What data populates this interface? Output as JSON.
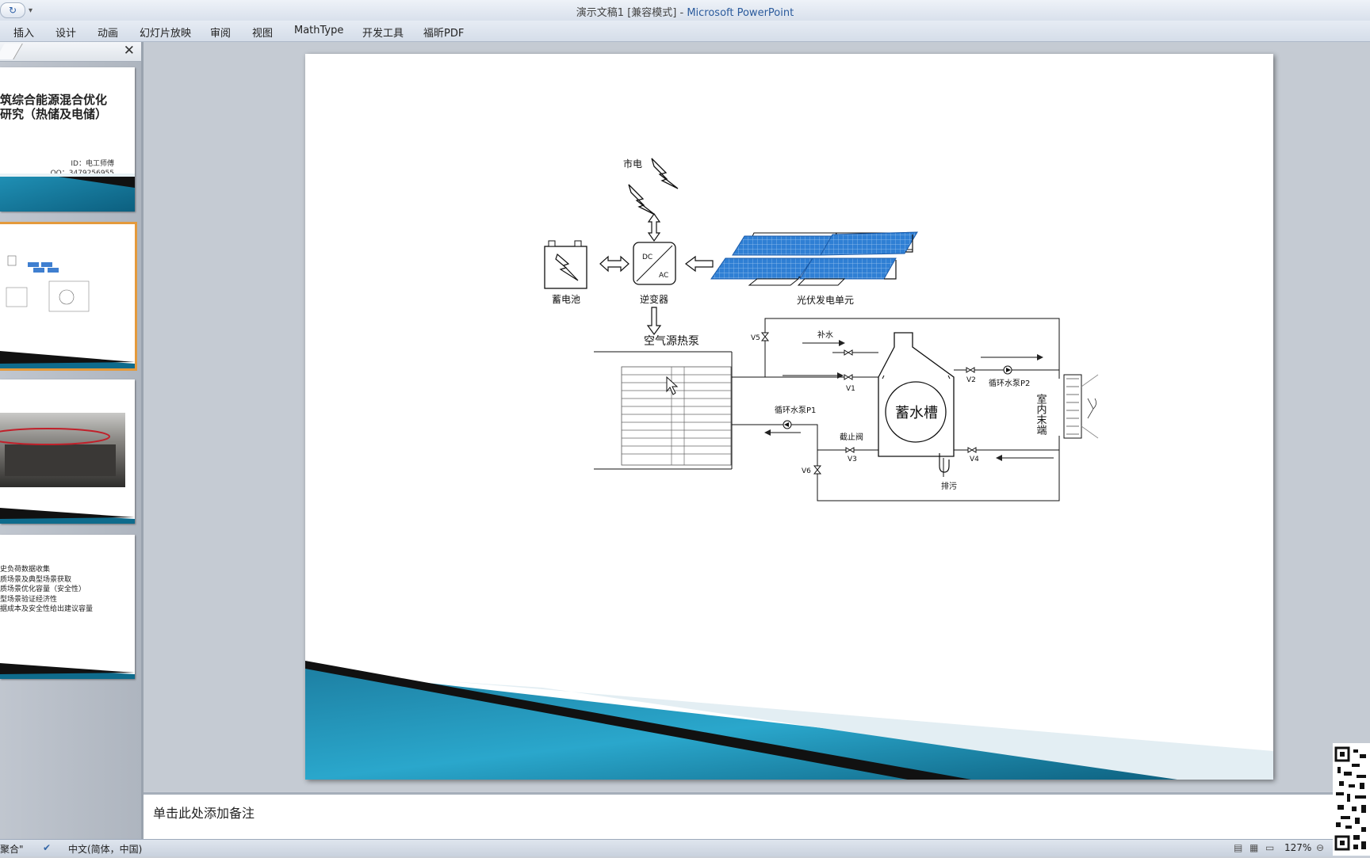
{
  "window": {
    "title_doc": "演示文稿1 [兼容模式] - ",
    "title_app": "Microsoft PowerPoint"
  },
  "ribbon": {
    "tabs": [
      "插入",
      "设计",
      "动画",
      "幻灯片放映",
      "审阅",
      "视图",
      "MathType",
      "开发工具",
      "福昕PDF"
    ]
  },
  "thumbnails": [
    {
      "title_line1": "筑综合能源混合优化",
      "title_line2": "研究（热储及电储）",
      "id_line": "ID：电工师傅",
      "qq_line": "QQ：3479256955"
    },
    {
      "selected": true
    },
    {},
    {
      "bullets": [
        "史负荷数据收集",
        "质场景及典型场景获取",
        "质场景优化容量（安全性）",
        "型场景验证经济性",
        "据成本及安全性给出建议容量"
      ]
    }
  ],
  "slide": {
    "labels": {
      "grid": "市电",
      "battery": "蓄电池",
      "inverter": "逆变器",
      "dc": "DC",
      "ac": "AC",
      "pv": "光伏发电单元",
      "heat_pump": "空气源热泵",
      "v5": "V5",
      "makeup_water": "补水",
      "v1": "V1",
      "v2": "V2",
      "pump_p2": "循环水泵P2",
      "indoor": "室内末端",
      "tank": "蓄水槽",
      "pump_p1": "循环水泵P1",
      "check_valve": "截止阀",
      "v3": "V3",
      "v4": "V4",
      "v6": "V6",
      "drain": "排污"
    }
  },
  "notes": {
    "placeholder": "单击此处添加备注"
  },
  "status": {
    "layout": "聚合\"",
    "language": "中文(简体，中国)",
    "zoom": "127%"
  }
}
